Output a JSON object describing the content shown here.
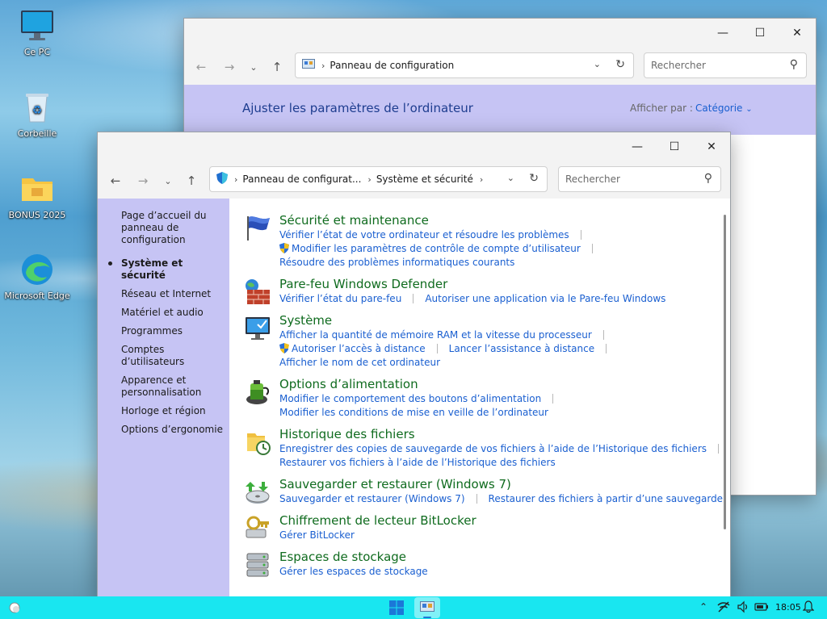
{
  "desktop": {
    "icons": [
      {
        "label": "Ce PC"
      },
      {
        "label": "Corbeille"
      },
      {
        "label": "BONUS 2025"
      },
      {
        "label": "Microsoft Edge"
      }
    ]
  },
  "back_window": {
    "address": "Panneau de configuration",
    "search_placeholder": "Rechercher",
    "heading": "Ajuster les paramètres de l’ordinateur",
    "view_by_label": "Afficher par :",
    "view_by_value": "Catégorie"
  },
  "front_window": {
    "address_crumbs": [
      "Panneau de configurat...",
      "Système et sécurité"
    ],
    "search_placeholder": "Rechercher",
    "sidebar": {
      "home": "Page d’accueil du panneau de configuration",
      "items": [
        "Système et sécurité",
        "Réseau et Internet",
        "Matériel et audio",
        "Programmes",
        "Comptes d’utilisateurs",
        "Apparence et personnalisation",
        "Horloge et région",
        "Options d’ergonomie"
      ]
    },
    "sections": [
      {
        "title": "Sécurité et maintenance",
        "icon": "flag-icon",
        "rows": [
          [
            "Vérifier l’état de votre ordinateur et résoudre les problèmes"
          ],
          [
            "Modifier les paramètres de contrôle de compte d’utilisateur"
          ],
          [
            "Résoudre des problèmes informatiques courants"
          ]
        ]
      },
      {
        "title": "Pare-feu Windows Defender",
        "icon": "firewall-icon",
        "rows": [
          [
            "Vérifier l’état du pare-feu",
            "Autoriser une application via le Pare-feu Windows"
          ]
        ]
      },
      {
        "title": "Système",
        "icon": "system-monitor-icon",
        "rows": [
          [
            "Afficher la quantité de mémoire RAM et la vitesse du processeur"
          ],
          [
            "Autoriser l’accès à distance",
            "Lancer l’assistance à distance"
          ],
          [
            "Afficher le nom de cet ordinateur"
          ]
        ]
      },
      {
        "title": "Options d’alimentation",
        "icon": "power-battery-icon",
        "rows": [
          [
            "Modifier le comportement des boutons d’alimentation"
          ],
          [
            "Modifier les conditions de mise en veille de l’ordinateur"
          ]
        ]
      },
      {
        "title": "Historique des fichiers",
        "icon": "file-history-icon",
        "rows": [
          [
            "Enregistrer des copies de sauvegarde de vos fichiers à l’aide de l’Historique des fichiers"
          ],
          [
            "Restaurer vos fichiers à l’aide de l’Historique des fichiers"
          ]
        ]
      },
      {
        "title": "Sauvegarder et restaurer (Windows 7)",
        "icon": "backup-restore-icon",
        "rows": [
          [
            "Sauvegarder et restaurer (Windows 7)",
            "Restaurer des fichiers à partir d’une sauvegarde"
          ]
        ]
      },
      {
        "title": "Chiffrement de lecteur BitLocker",
        "icon": "bitlocker-icon",
        "rows": [
          [
            "Gérer BitLocker"
          ]
        ]
      },
      {
        "title": "Espaces de stockage",
        "icon": "storage-spaces-icon",
        "rows": [
          [
            "Gérer les espaces de stockage"
          ]
        ]
      }
    ]
  },
  "taskbar": {
    "clock": "18:05"
  },
  "colors": {
    "sidebar_bg": "#c6c4f4",
    "link": "#1a5fd0",
    "section_title": "#0f6b1e",
    "taskbar_bg": "#19e6f0"
  }
}
